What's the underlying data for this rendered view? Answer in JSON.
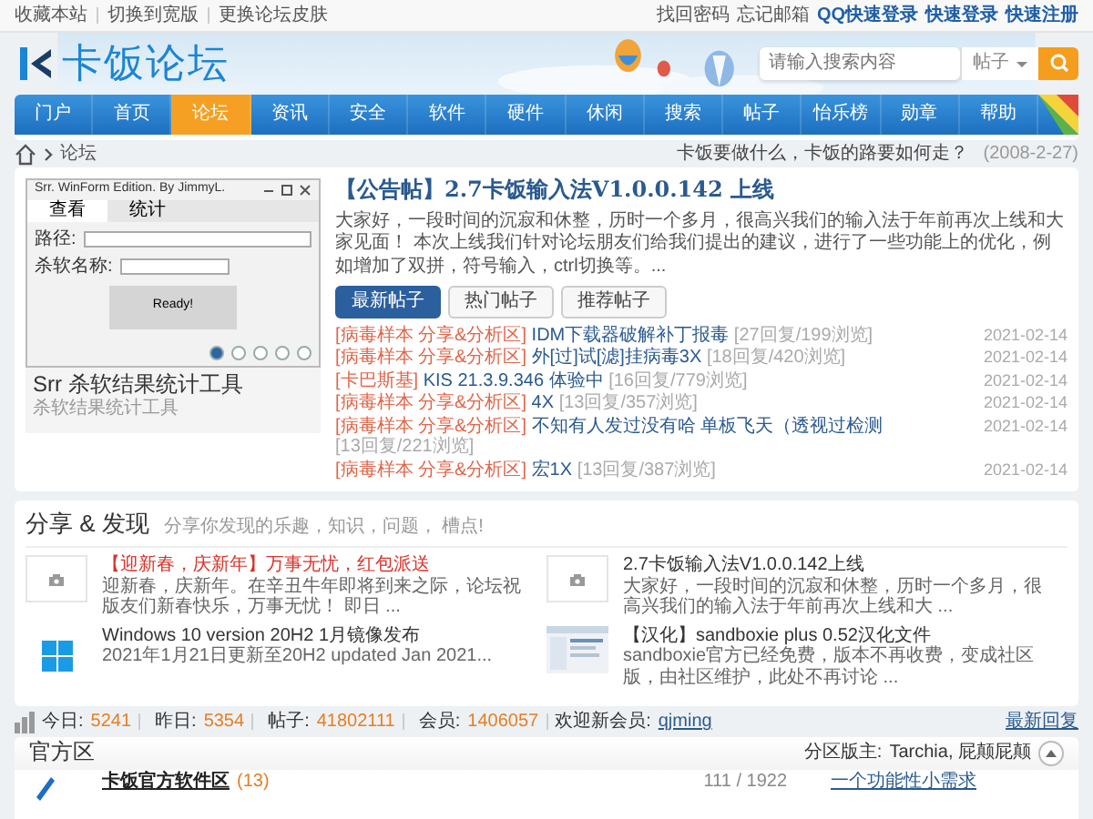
{
  "top_bar": {
    "left_links": [
      "收藏本站",
      "切换到宽版",
      "更换论坛皮肤"
    ],
    "right_links": [
      {
        "text": "找回密码",
        "bold": false
      },
      {
        "text": "忘记邮箱",
        "bold": false
      },
      {
        "text": "QQ快速登录",
        "bold": true
      },
      {
        "text": "快速登录",
        "bold": true
      },
      {
        "text": "快速注册",
        "bold": true
      }
    ]
  },
  "header": {
    "logo": "卡饭论坛",
    "search": {
      "placeholder": "请输入搜索内容",
      "scope": "帖子"
    }
  },
  "nav": [
    {
      "label": "门户",
      "selected": false
    },
    {
      "label": "首页",
      "selected": false
    },
    {
      "label": "论坛",
      "selected": true
    },
    {
      "label": "资讯",
      "selected": false
    },
    {
      "label": "安全",
      "selected": false
    },
    {
      "label": "软件",
      "selected": false
    },
    {
      "label": "硬件",
      "selected": false
    },
    {
      "label": "休闲",
      "selected": false
    },
    {
      "label": "搜索",
      "selected": false
    },
    {
      "label": "帖子",
      "selected": false
    },
    {
      "label": "怡乐榜",
      "selected": false
    },
    {
      "label": "勋章",
      "selected": false
    },
    {
      "label": "帮助",
      "selected": false
    }
  ],
  "breadcrumb": {
    "current": "论坛"
  },
  "announcement": {
    "text": "卡饭要做什么，卡饭的路要如何走？",
    "date": "(2008-2-27)"
  },
  "slider": {
    "app_window": {
      "title": "Srr. WinForm Edition.   By   JimmyL.",
      "tabs": [
        {
          "label": "查看",
          "selected": true
        },
        {
          "label": "统计",
          "selected": false
        }
      ],
      "fields": [
        "路径:",
        "杀软名称:"
      ],
      "button": "Ready!"
    },
    "title": "Srr 杀软结果统计工具",
    "subtitle": "杀软结果统计工具",
    "dots": [
      {
        "selected": true
      },
      {
        "selected": false
      },
      {
        "selected": false
      },
      {
        "selected": false
      },
      {
        "selected": false
      }
    ]
  },
  "featured": {
    "title": "【公告帖】2.7卡饭输入法V1.0.0.142 上线",
    "summary": "大家好，一段时间的沉寂和休整，历时一个多月，很高兴我们的输入法于年前再次上线和大家见面！ 本次上线我们针对论坛朋友们给我们提出的建议，进行了一些功能上的优化，例如增加了双拼，符号输入，ctrl切换等。..."
  },
  "post_tabs": [
    {
      "label": "最新帖子",
      "selected": true
    },
    {
      "label": "热门帖子",
      "selected": false
    },
    {
      "label": "推荐帖子",
      "selected": false
    }
  ],
  "posts": [
    {
      "category": "[病毒样本 分享&分析区]",
      "title": "IDM下载器破解补丁报毒",
      "stats": "[27回复/199浏览]",
      "date": "2021-02-14"
    },
    {
      "category": "[病毒样本 分享&分析区]",
      "title": "外[过]试[滤]挂病毒3X",
      "stats": "[18回复/420浏览]",
      "date": "2021-02-14"
    },
    {
      "category": "[卡巴斯基]",
      "title": "KIS 21.3.9.346 体验中",
      "stats": "[16回复/779浏览]",
      "date": "2021-02-14"
    },
    {
      "category": "[病毒样本 分享&分析区]",
      "title": "4X",
      "stats": "[13回复/357浏览]",
      "date": "2021-02-14"
    },
    {
      "category": "[病毒样本 分享&分析区]",
      "title": "不知有人发过没有哈 单板飞天（透视过检测",
      "stats": "[13回复/221浏览]",
      "date": "2021-02-14"
    },
    {
      "category": "[病毒样本 分享&分析区]",
      "title": "宏1X",
      "stats": "[13回复/387浏览]",
      "date": "2021-02-14"
    }
  ],
  "share": {
    "title": "分享 & 发现",
    "subtitle": "分享你发现的乐趣，知识，问题， 槽点!",
    "items": [
      {
        "kind": "camera",
        "highlight": true,
        "title": "【迎新春，庆新年】万事无忧，红包派送",
        "summary": "迎新春，庆新年。在辛丑牛年即将到来之际，论坛祝版友们新春快乐，万事无忧！ 即日 ..."
      },
      {
        "kind": "camera",
        "highlight": false,
        "title": "2.7卡饭输入法V1.0.0.142上线",
        "summary": "大家好，一段时间的沉寂和休整，历时一个多月，很高兴我们的输入法于年前再次上线和大 ..."
      },
      {
        "kind": "windows",
        "highlight": false,
        "title": "Windows 10 version 20H2 1月镜像发布",
        "summary": "2021年1月21日更新至20H2 updated Jan 2021..."
      },
      {
        "kind": "picture",
        "highlight": false,
        "title": "【汉化】sandboxie plus 0.52汉化文件",
        "summary": "sandboxie官方已经免费，版本不再收费，变成社区版，由社区维护，此处不再讨论 ..."
      }
    ]
  },
  "stats": {
    "items": [
      {
        "label": "今日:",
        "value": "5241"
      },
      {
        "label": "昨日:",
        "value": "5354"
      },
      {
        "label": "帖子:",
        "value": "41802111"
      },
      {
        "label": "会员:",
        "value": "1406057"
      }
    ],
    "welcome_label": "欢迎新会员:",
    "new_member": "qjming",
    "latest_link": "最新回复"
  },
  "section": {
    "title": "官方区",
    "moderators_label": "分区版主:",
    "moderators": "Tarchia, 屁颠屁颠",
    "expanded": true,
    "forums": [
      {
        "name": "卡饭官方软件区",
        "count": "(13)",
        "stats": "111 / 1922",
        "last_post": "一个功能性小需求"
      }
    ]
  }
}
